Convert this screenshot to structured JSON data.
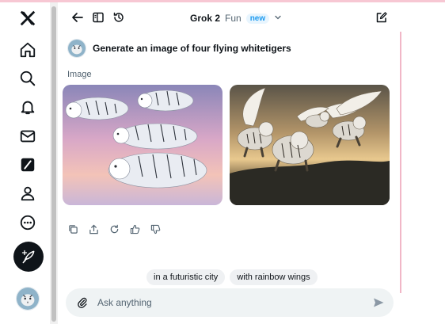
{
  "nav": {
    "items": [
      {
        "name": "x-logo-icon"
      },
      {
        "name": "home-icon"
      },
      {
        "name": "search-icon"
      },
      {
        "name": "notifications-icon"
      },
      {
        "name": "messages-icon"
      },
      {
        "name": "grok-icon"
      },
      {
        "name": "profile-icon"
      },
      {
        "name": "more-icon"
      }
    ],
    "compose_icon": "feather-plus-icon"
  },
  "header": {
    "model_name": "Grok 2",
    "model_variant": "Fun",
    "badge": "new"
  },
  "conversation": {
    "prompt": "Generate an image of four flying whitetigers",
    "section_label": "Image"
  },
  "actions": [
    "copy-icon",
    "share-icon",
    "regenerate-icon",
    "thumbs-up-icon",
    "thumbs-down-icon"
  ],
  "suggestions": [
    "in a futuristic city",
    "with rainbow wings"
  ],
  "composer": {
    "placeholder": "Ask anything"
  },
  "colors": {
    "accent": "#1d9bf0",
    "text": "#0f1419",
    "muted": "#536471",
    "composer_bg": "#eff3f4",
    "chip_bg": "#eff1f3"
  }
}
